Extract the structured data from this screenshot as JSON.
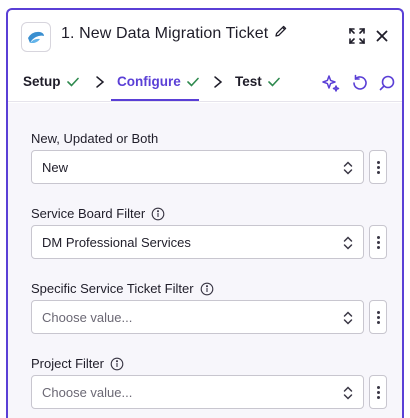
{
  "header": {
    "title": "1. New Data Migration Ticket",
    "icons": [
      "app-logo-icon",
      "pencil-icon",
      "expand-icon",
      "close-icon"
    ]
  },
  "tabs": [
    {
      "label": "Setup",
      "status": "complete"
    },
    {
      "label": "Configure",
      "status": "complete",
      "active": true
    },
    {
      "label": "Test",
      "status": "complete"
    }
  ],
  "toolbar_icons": [
    "sparkle-ai-icon",
    "undo-icon",
    "search-icon"
  ],
  "fields": [
    {
      "label": "New, Updated or Both",
      "value": "New",
      "placeholder": "",
      "has_info": false
    },
    {
      "label": "Service Board Filter",
      "value": "DM Professional Services",
      "placeholder": "",
      "has_info": true
    },
    {
      "label": "Specific Service Ticket Filter",
      "value": "",
      "placeholder": "Choose value...",
      "has_info": true
    },
    {
      "label": "Project Filter",
      "value": "",
      "placeholder": "Choose value...",
      "has_info": true
    }
  ],
  "colors": {
    "accent": "#5a3fd6",
    "check": "#2f8a4f",
    "form_bg": "#f7f6fb"
  }
}
